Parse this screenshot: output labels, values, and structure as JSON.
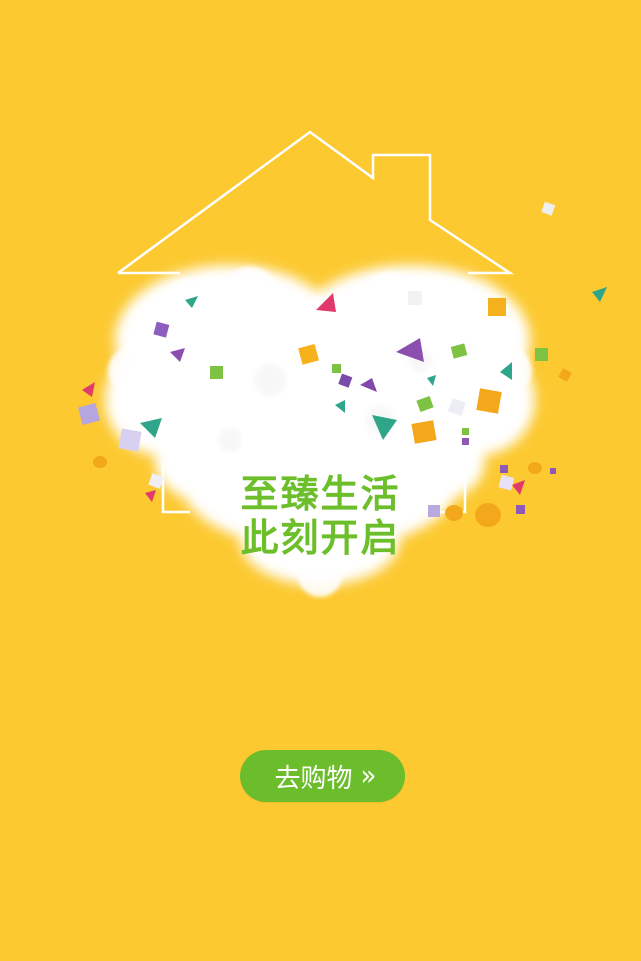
{
  "hero": {
    "line1": "至臻生活",
    "line2": "此刻开启"
  },
  "cta": {
    "label": "去购物",
    "arrow": "»"
  },
  "colors": {
    "background": "#FCC930",
    "accent": "#6CBE2B",
    "button": "#6BBD2B",
    "outline": "#FFFFFF"
  },
  "icons": {
    "house": "house-outline-icon",
    "cloud_heart": "cloud-heart-icon",
    "confetti": "confetti-cubes"
  }
}
